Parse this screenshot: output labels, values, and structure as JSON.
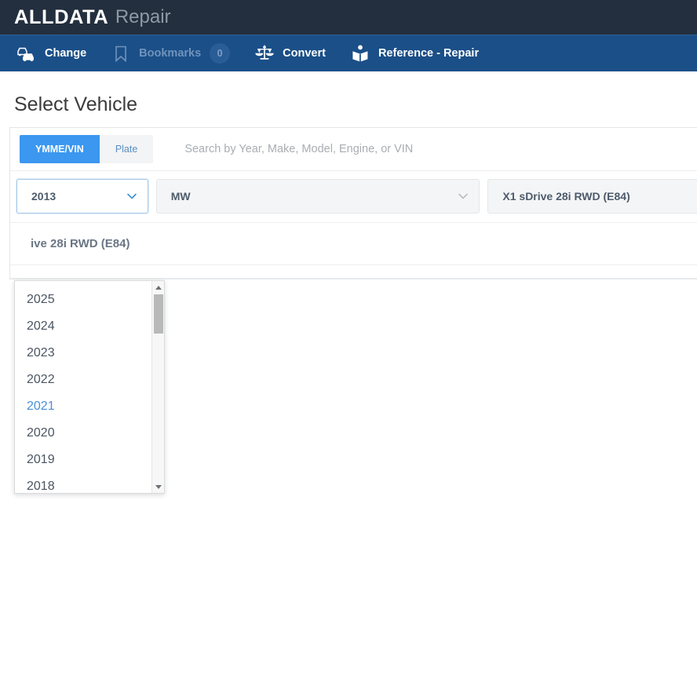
{
  "brand": {
    "name": "ALLDATA",
    "product": "Repair"
  },
  "nav": {
    "items": [
      {
        "label": "Change",
        "icon": "two-cars-icon",
        "state": "enabled",
        "badge": null
      },
      {
        "label": "Bookmarks",
        "icon": "bookmark-icon",
        "state": "disabled",
        "badge": "0"
      },
      {
        "label": "Convert",
        "icon": "balance-scale-icon",
        "state": "enabled",
        "badge": null
      },
      {
        "label": "Reference - Repair",
        "icon": "person-reading-book-icon",
        "state": "enabled",
        "badge": null
      }
    ]
  },
  "page": {
    "title": "Select Vehicle"
  },
  "search": {
    "tabs": [
      {
        "label": "YMME/VIN",
        "active": true
      },
      {
        "label": "Plate",
        "active": false
      }
    ],
    "placeholder": "Search by Year, Make, Model, Engine, or VIN",
    "value": ""
  },
  "selectors": {
    "year": {
      "value": "2013",
      "open": true,
      "icon": "chevron-down-icon"
    },
    "make": {
      "value": "MW",
      "open": false,
      "icon": "chevron-down-icon"
    },
    "model": {
      "value": "X1 sDrive 28i RWD (E84)",
      "open": false,
      "icon": "chevron-down-icon"
    }
  },
  "year_dropdown": {
    "options": [
      "2025",
      "2024",
      "2023",
      "2022",
      "2021",
      "2020",
      "2019",
      "2018"
    ],
    "highlighted": "2021",
    "scrollbar": {
      "up_arrow": "scroll-up-arrow-icon",
      "down_arrow": "scroll-down-arrow-icon"
    }
  },
  "vehicle_summary": {
    "text": "ive 28i RWD (E84)"
  },
  "colors": {
    "brand_bar": "#232f3e",
    "nav_bar": "#1b4f87",
    "accent_blue": "#3b97f0",
    "highlight_blue": "#4a90d9",
    "text_dark": "#3b3b3b",
    "muted": "#a9adb2"
  }
}
